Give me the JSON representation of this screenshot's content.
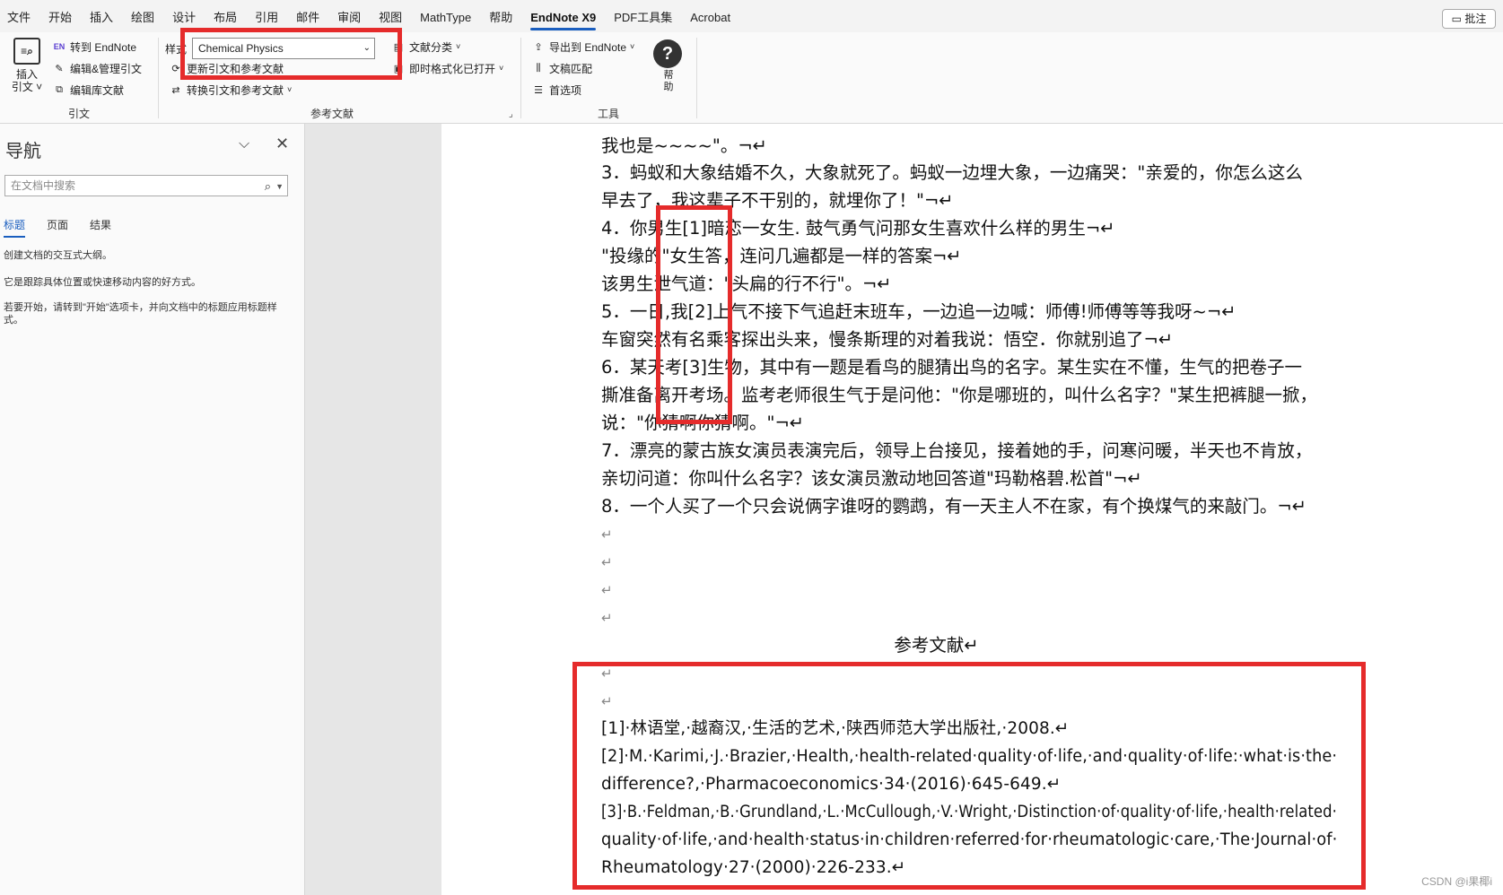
{
  "menubar": {
    "tabs": [
      "文件",
      "开始",
      "插入",
      "绘图",
      "设计",
      "布局",
      "引用",
      "邮件",
      "审阅",
      "视图",
      "MathType",
      "帮助",
      "EndNote X9",
      "PDF工具集",
      "Acrobat"
    ],
    "active_tab": "EndNote X9",
    "comment_button": "批注"
  },
  "ribbon": {
    "insert_citation": {
      "line1": "插入",
      "line2": "引文",
      "icon": "insert-citation-icon"
    },
    "goto_endnote": "转到 EndNote",
    "edit_manage_citations": "编辑&管理引文",
    "edit_library_refs": "编辑库文献",
    "group_citations": "引文",
    "style_label": "样式",
    "style_value": "Chemical Physics",
    "update_citations": "更新引文和参考文献",
    "convert_citations": "转换引文和参考文献",
    "categorize_refs": "文献分类",
    "instant_format": "即时格式化已打开",
    "group_bibliography": "参考文献",
    "export_to_endnote": "导出到 EndNote",
    "manuscript_matcher": "文稿匹配",
    "preferences": "首选项",
    "group_tools": "工具",
    "help": {
      "line1": "帮",
      "line2": "助"
    }
  },
  "nav": {
    "title": "导航",
    "search_placeholder": "在文档中搜索",
    "tabs": [
      "标题",
      "页面",
      "结果"
    ],
    "active_tab": "标题",
    "text1": "创建文档的交互式大纲。",
    "text2": "它是跟踪具体位置或快速移动内容的好方式。",
    "text3": "若要开始，请转到\"开始\"选项卡，并向文档中的标题应用标题样式。"
  },
  "document": {
    "lines": [
      "我也是~~~~\"。¬↵",
      "3．蚂蚁和大象结婚不久，大象就死了。蚂蚁一边埋大象，一边痛哭：\"亲爱的，你怎么这么",
      "早去了，我这辈子不干别的，就埋你了！\"¬↵",
      "4．你男生[1]暗恋一女生. 鼓气勇气问那女生喜欢什么样的男生¬↵",
      "\"投缘的\"女生答，连问几遍都是一样的答案¬↵",
      "该男生泄气道：\"头扁的行不行\"。¬↵",
      "5．一日,我[2]上气不接下气追赶末班车，一边追一边喊：师傅!师傅等等我呀~¬↵",
      "车窗突然有名乘客探出头来，慢条斯理的对着我说：悟空．你就别追了¬↵",
      "6．某天考[3]生物，其中有一题是看鸟的腿猜出鸟的名字。某生实在不懂，生气的把卷子一",
      "撕准备离开考场。监考老师很生气于是问他：\"你是哪班的，叫什么名字？\"某生把裤腿一掀，",
      "说：\"你猜啊你猜啊。\"¬↵",
      "7．漂亮的蒙古族女演员表演完后，领导上台接见，接着她的手，问寒问暖，半天也不肯放，",
      "亲切问道：你叫什么名字？该女演员激动地回答道\"玛勒格碧.松首\"¬↵",
      "8．一个人买了一个只会说俩字谁呀的鹦鹉，有一天主人不在家，有个换煤气的来敲门。¬↵"
    ],
    "para_mark": "↵",
    "ref_heading": "参考文献↵",
    "references": [
      "[1]·林语堂,·越裔汉,·生活的艺术,·陕西师范大学出版社,·2008.↵",
      "[2]·M.·Karimi,·J.·Brazier,·Health,·health-related·quality·of·life,·and·quality·of·life:·what·is·the·",
      "difference?,·Pharmacoeconomics·34·(2016)·645-649.↵",
      "[3]·B.·Feldman,·B.·Grundland,·L.·McCullough,·V.·Wright,·Distinction·of·quality·of·life,·health·related·",
      "quality·of·life,·and·health·status·in·children·referred·for·rheumatologic·care,·The·Journal·of·",
      "Rheumatology·27·(2000)·226-233.↵"
    ]
  },
  "watermark": "CSDN @i果椰i",
  "colors": {
    "highlight": "#e52b2b",
    "accent": "#1a5ebf"
  }
}
